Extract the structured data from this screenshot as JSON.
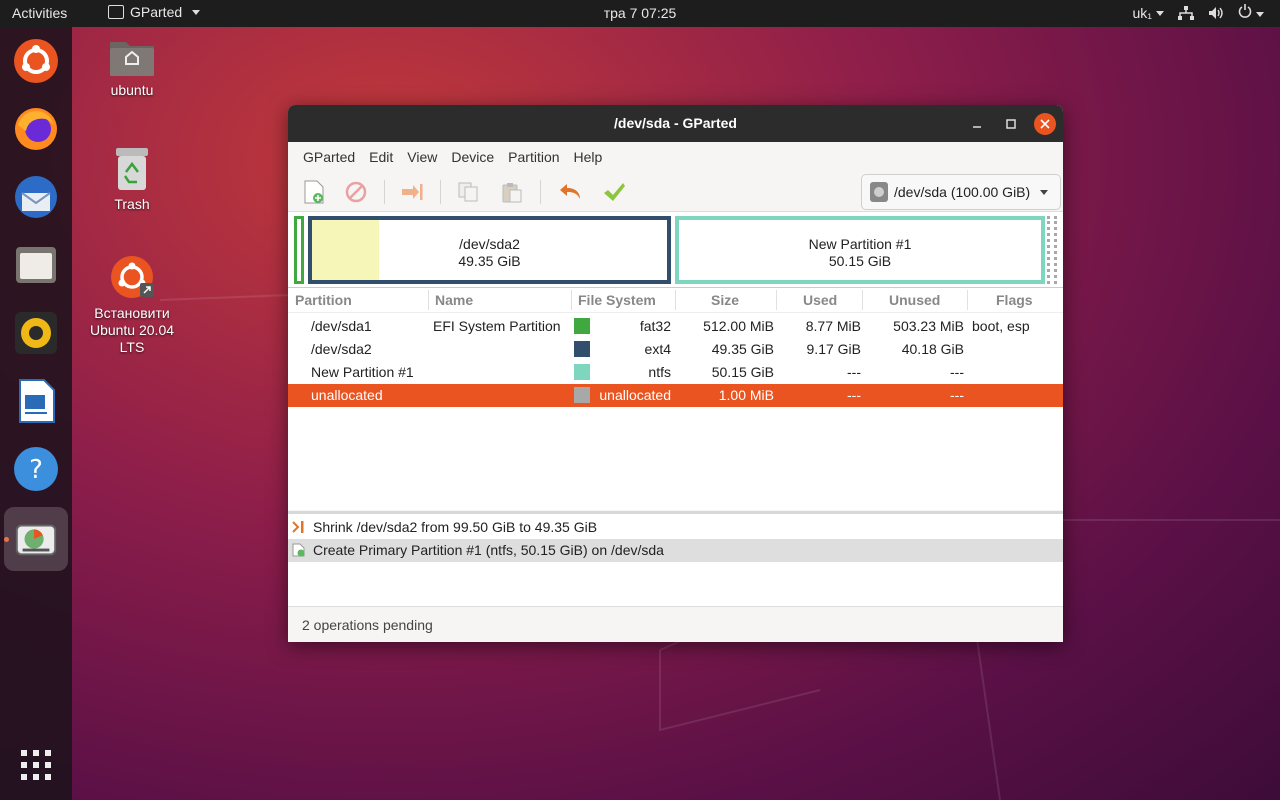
{
  "topbar": {
    "activities": "Activities",
    "app_name": "GParted",
    "clock": "тра 7  07:25",
    "keyboard": "uk₁"
  },
  "dock": {
    "items": [
      "ubuntu-software-icon",
      "firefox-icon",
      "thunderbird-icon",
      "files-icon",
      "rhythmbox-icon",
      "libreoffice-writer-icon",
      "help-icon",
      "gparted-icon"
    ],
    "show_apps": "grid-icon"
  },
  "desktop": {
    "home_label": "ubuntu",
    "trash_label": "Trash",
    "install_label_line1": "Встановити",
    "install_label_line2": "Ubuntu 20.04",
    "install_label_line3": "LTS"
  },
  "window": {
    "title": "/dev/sda - GParted",
    "menu": [
      "GParted",
      "Edit",
      "View",
      "Device",
      "Partition",
      "Help"
    ],
    "device_selector": "/dev/sda (100.00 GiB)"
  },
  "partition_map": [
    {
      "name": "/dev/sda2",
      "size": "49.35 GiB",
      "used_fraction": 0.19
    },
    {
      "name": "New Partition #1",
      "size": "50.15 GiB"
    }
  ],
  "table": {
    "columns": [
      "Partition",
      "Name",
      "File System",
      "Size",
      "Used",
      "Unused",
      "Flags"
    ],
    "rows": [
      {
        "partition": "/dev/sda1",
        "name": "EFI System Partition",
        "fs": "fat32",
        "size": "512.00 MiB",
        "used": "8.77 MiB",
        "unused": "503.23 MiB",
        "flags": "boot, esp",
        "color": "#3fa83f"
      },
      {
        "partition": "/dev/sda2",
        "name": "",
        "fs": "ext4",
        "size": "49.35 GiB",
        "used": "9.17 GiB",
        "unused": "40.18 GiB",
        "flags": "",
        "color": "#314e6c"
      },
      {
        "partition": "New Partition #1",
        "name": "",
        "fs": "ntfs",
        "size": "50.15 GiB",
        "used": "---",
        "unused": "---",
        "flags": "",
        "color": "#7fd6be"
      },
      {
        "partition": "unallocated",
        "name": "",
        "fs": "unallocated",
        "size": "1.00 MiB",
        "used": "---",
        "unused": "---",
        "flags": "",
        "color": "#a8a8a8"
      }
    ]
  },
  "operations": [
    "Shrink /dev/sda2 from 99.50 GiB to 49.35 GiB",
    "Create Primary Partition #1 (ntfs, 50.15 GiB) on /dev/sda"
  ],
  "status": "2 operations pending",
  "colors": {
    "accent": "#e95420",
    "ext4_border": "#314e6c",
    "ntfs_border": "#7fd6be",
    "used_fill": "#f6f6b8"
  }
}
